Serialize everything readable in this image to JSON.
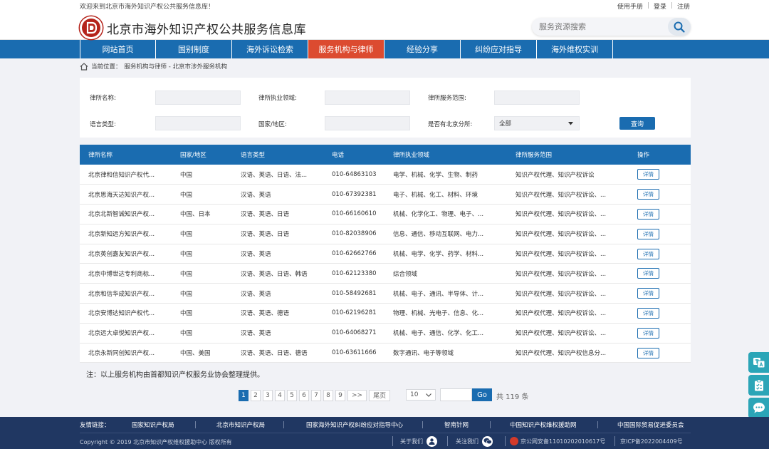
{
  "topbar": {
    "welcome": "欢迎来到北京市海外知识产权公共服务信息库！",
    "manual": "使用手册",
    "login": "登录",
    "register": "注册"
  },
  "header": {
    "site_title": "北京市海外知识产权公共服务信息库",
    "search_placeholder": "服务资源搜索"
  },
  "nav": {
    "items": [
      "网站首页",
      "国别制度",
      "海外诉讼检索",
      "服务机构与律师",
      "经验分享",
      "纠纷应对指导",
      "海外维权实训"
    ]
  },
  "breadcrumb": {
    "prefix": "当前位置：",
    "path": "服务机构与律师 - 北京市涉外服务机构"
  },
  "filter": {
    "firm_name_label": "律所名称:",
    "practice_area_label": "律所执业领域:",
    "service_scope_label": "律所服务范围:",
    "language_label": "语言类型:",
    "country_label": "国家/地区:",
    "beijing_branch_label": "是否有北京分所:",
    "beijing_branch_value": "全部",
    "query_button": "查询"
  },
  "table": {
    "headers": [
      "律所名称",
      "国家/地区",
      "语言类型",
      "电话",
      "律所执业领域",
      "律所服务范围",
      "操作"
    ],
    "detail_label": "详情",
    "rows": [
      {
        "name": "北京律和信知识产权代...",
        "country": "中国",
        "lang": "汉语、英语、日语、法...",
        "phone": "010-64863103",
        "area": "电学、机械、化学、生物、制药",
        "scope": "知识产权代理、知识产权诉讼"
      },
      {
        "name": "北京思海天达知识产权...",
        "country": "中国",
        "lang": "汉语、英语",
        "phone": "010-67392381",
        "area": "电子、机械、化工、材料、环境",
        "scope": "知识产权代理、知识产权诉讼、..."
      },
      {
        "name": "北京北新智诚知识产权...",
        "country": "中国、日本",
        "lang": "汉语、英语、日语",
        "phone": "010-66160610",
        "area": "机械、化学化工、物理、电子、...",
        "scope": "知识产权代理、知识产权诉讼、..."
      },
      {
        "name": "北京新知远方知识产权...",
        "country": "中国",
        "lang": "汉语、英语、日语",
        "phone": "010-82038906",
        "area": "信息、通信、移动互联网、电力...",
        "scope": "知识产权代理、知识产权诉讼、..."
      },
      {
        "name": "北京英创嘉友知识产权...",
        "country": "中国",
        "lang": "汉语、英语",
        "phone": "010-62662766",
        "area": "机械、电学、化学、药学、材料...",
        "scope": "知识产权代理、知识产权诉讼、..."
      },
      {
        "name": "北京中博世达专利商标...",
        "country": "中国",
        "lang": "汉语、英语、日语、韩语",
        "phone": "010-62123380",
        "area": "综合领域",
        "scope": "知识产权代理、知识产权诉讼、..."
      },
      {
        "name": "北京和信华成知识产权...",
        "country": "中国",
        "lang": "汉语、英语",
        "phone": "010-58492681",
        "area": "机械、电子、通讯、半导体、计...",
        "scope": "知识产权代理、知识产权诉讼、..."
      },
      {
        "name": "北京安博达知识产权代...",
        "country": "中国",
        "lang": "汉语、英语、德语",
        "phone": "010-62196281",
        "area": "物理、机械、光电子、信息、化...",
        "scope": "知识产权代理、知识产权诉讼、..."
      },
      {
        "name": "北京远大卓悦知识产权...",
        "country": "中国",
        "lang": "汉语、英语",
        "phone": "010-64068271",
        "area": "机械、电子、通信、化学、化工...",
        "scope": "知识产权代理、知识产权诉讼、..."
      },
      {
        "name": "北京永新同创知识产权...",
        "country": "中国、美国",
        "lang": "汉语、英语、日语、德语",
        "phone": "010-63611666",
        "area": "数字通讯、电子等领域",
        "scope": "知识产权代理、知识产权信息分..."
      }
    ]
  },
  "note": "注：以上服务机构由首都知识产权服务业协会整理提供。",
  "pagination": {
    "pages": [
      "1",
      "2",
      "3",
      "4",
      "5",
      "6",
      "7",
      "8",
      "9"
    ],
    "next": ">>",
    "last": "尾页",
    "page_size": "10",
    "go": "Go",
    "total": "共 119 条"
  },
  "footer": {
    "friend_label": "友情链接：",
    "links": [
      "国家知识产权局",
      "北京市知识产权局",
      "国家海外知识产权纠纷应对指导中心",
      "智南针网",
      "中国知识产权维权援助网",
      "中国国际贸易促进委员会"
    ],
    "copyright": "Copyright © 2019 北京市知识产权维权援助中心 版权所有",
    "about": "关于我们",
    "follow": "关注我们",
    "police": "京公网安备11010202010617号",
    "icp": "京ICP备2022004409号"
  },
  "colors": {
    "primary": "#1a6cb0",
    "active_nav": "#dc4b30",
    "footer": "#203762",
    "side_widget": "#2ba5b7"
  }
}
